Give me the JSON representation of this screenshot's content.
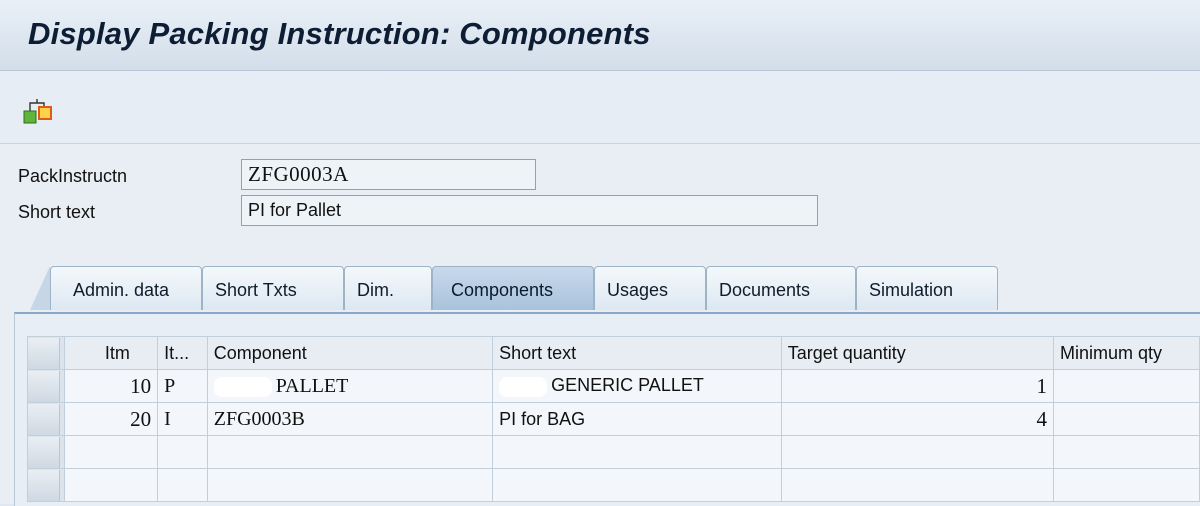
{
  "window": {
    "title": "Display Packing Instruction: Components"
  },
  "toolbar": {
    "icons": [
      "hierarchy-icon"
    ]
  },
  "header": {
    "pack_instr_label": "PackInstructn",
    "pack_instr_value": "ZFG0003A",
    "short_text_label": "Short text",
    "short_text_value": "PI for Pallet"
  },
  "tabs": [
    {
      "label": "Admin. data",
      "active": false
    },
    {
      "label": "Short Txts",
      "active": false
    },
    {
      "label": "Dim.",
      "active": false
    },
    {
      "label": "Components",
      "active": true
    },
    {
      "label": "Usages",
      "active": false
    },
    {
      "label": "Documents",
      "active": false
    },
    {
      "label": "Simulation",
      "active": false
    }
  ],
  "table": {
    "columns": [
      "Itm",
      "It...",
      "Component",
      "Short text",
      "Target quantity",
      "Minimum qty"
    ],
    "rows": [
      {
        "itm": "10",
        "it": "P",
        "component": "PALLET",
        "short_text": "GENERIC PALLET",
        "target_qty": "1",
        "min_qty": ""
      },
      {
        "itm": "20",
        "it": "I",
        "component": "ZFG0003B",
        "short_text": "PI for BAG",
        "target_qty": "4",
        "min_qty": ""
      }
    ]
  }
}
